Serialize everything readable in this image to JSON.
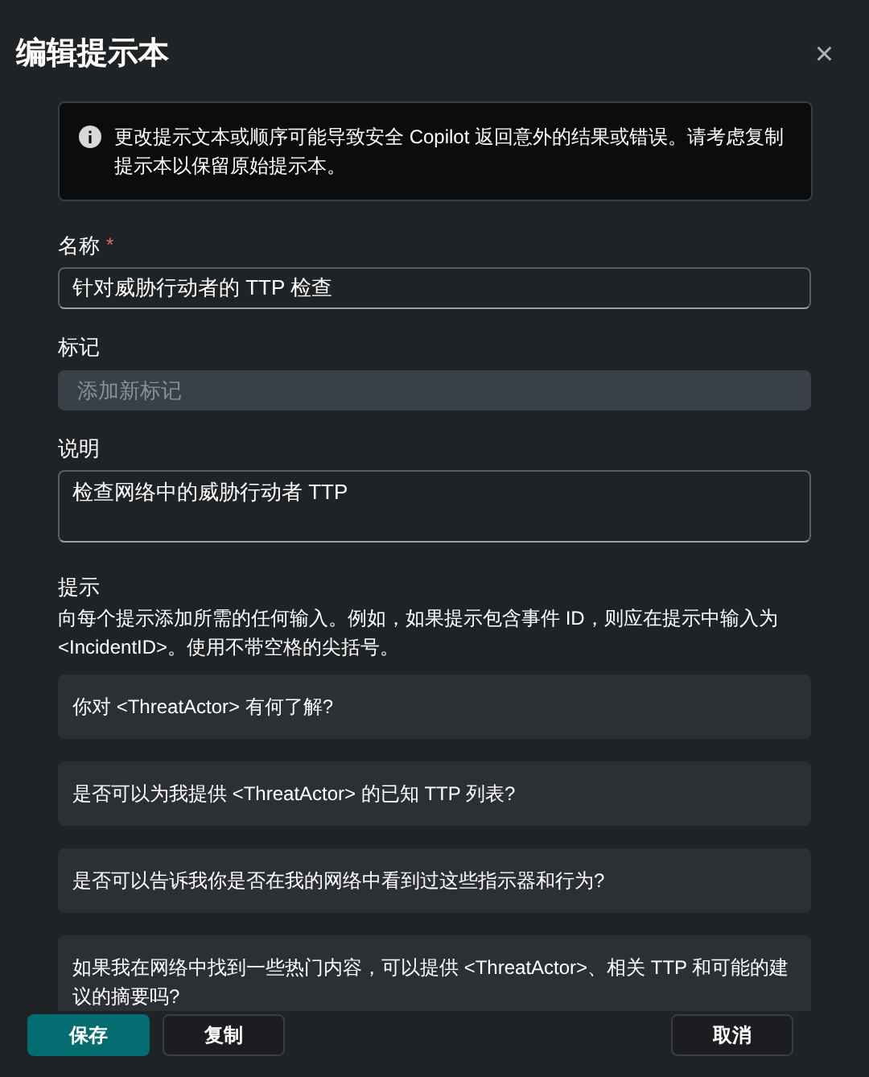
{
  "dialog": {
    "title": "编辑提示本",
    "close": "×"
  },
  "notice": {
    "text": "更改提示文本或顺序可能导致安全 Copilot 返回意外的结果或错误。请考虑复制提示本以保留原始提示本。"
  },
  "fields": [
    {
      "kind": "input",
      "label": "名称",
      "required_mark": "*",
      "value": "针对威胁行动者的 TTP 检查"
    },
    {
      "kind": "tags",
      "label": "标记",
      "placeholder": "添加新标记"
    },
    {
      "kind": "textarea",
      "label": "说明",
      "value": "检查网络中的威胁行动者 TTP"
    }
  ],
  "prompts": {
    "label": "提示",
    "hint": "向每个提示添加所需的任何输入。例如，如果提示包含事件 ID，则应在提示中输入为 <IncidentID>。使用不带空格的尖括号。",
    "items": [
      "你对 <ThreatActor> 有何了解?",
      "是否可以为我提供 <ThreatActor> 的已知 TTP 列表?",
      "是否可以告诉我你是否在我的网络中看到过这些指示器和行为?",
      "如果我在网络中找到一些热门内容，可以提供 <ThreatActor>、相关 TTP 和可能的建议的摘要吗?"
    ]
  },
  "buttons": [
    {
      "label": "保存",
      "kind": "primary"
    },
    {
      "label": "复制",
      "kind": "secondary"
    },
    {
      "label": "取消",
      "kind": "secondary"
    }
  ]
}
